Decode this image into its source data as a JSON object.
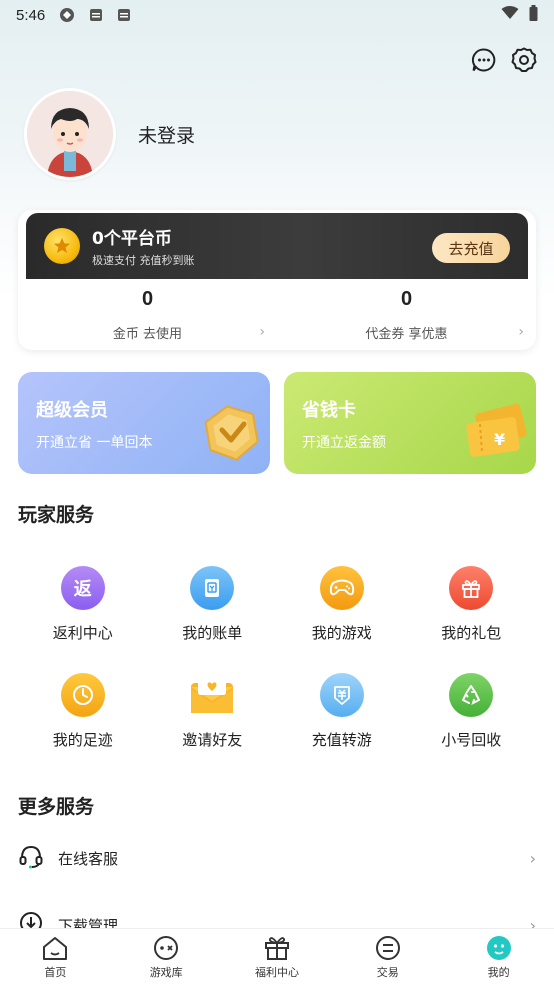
{
  "status_bar": {
    "time": "5:46"
  },
  "profile": {
    "name": "未登录"
  },
  "coin": {
    "title": "0个平台币",
    "subtitle": "极速支付 充值秒到账",
    "recharge": "去充值",
    "stats": [
      {
        "value": "0",
        "label": "金币 去使用"
      },
      {
        "value": "0",
        "label": "代金券 享优惠"
      }
    ]
  },
  "promos": {
    "vip": {
      "title": "超级会员",
      "subtitle": "开通立省 一单回本"
    },
    "save": {
      "title": "省钱卡",
      "subtitle": "开通立返金额"
    }
  },
  "player_services": {
    "title": "玩家服务",
    "items": [
      {
        "label": "返利中心",
        "icon": "rebate-icon",
        "glyph": "返",
        "color": "#9b6cf0"
      },
      {
        "label": "我的账单",
        "icon": "bill-icon",
        "glyph": "",
        "color": "#4aa9ef"
      },
      {
        "label": "我的游戏",
        "icon": "gamepad-icon",
        "glyph": "",
        "color": "#f6a317"
      },
      {
        "label": "我的礼包",
        "icon": "gift-icon",
        "glyph": "",
        "color": "#f0573d"
      },
      {
        "label": "我的足迹",
        "icon": "clock-icon",
        "glyph": "",
        "color": "#f6b21a"
      },
      {
        "label": "邀请好友",
        "icon": "envelope-icon",
        "glyph": "",
        "color": "#f6b21a"
      },
      {
        "label": "充值转游",
        "icon": "transfer-icon",
        "glyph": "",
        "color": "#5ab2ef"
      },
      {
        "label": "小号回收",
        "icon": "recycle-icon",
        "glyph": "",
        "color": "#5cc24a"
      }
    ]
  },
  "more_services": {
    "title": "更多服务",
    "items": [
      {
        "label": "在线客服",
        "icon": "headset-icon"
      },
      {
        "label": "下载管理",
        "icon": "download-icon"
      }
    ]
  },
  "tabbar": {
    "items": [
      {
        "label": "首页",
        "icon": "home-icon"
      },
      {
        "label": "游戏库",
        "icon": "game-library-icon"
      },
      {
        "label": "福利中心",
        "icon": "welfare-gift-icon"
      },
      {
        "label": "交易",
        "icon": "trade-icon"
      },
      {
        "label": "我的",
        "icon": "me-icon"
      }
    ],
    "active": "我的"
  }
}
